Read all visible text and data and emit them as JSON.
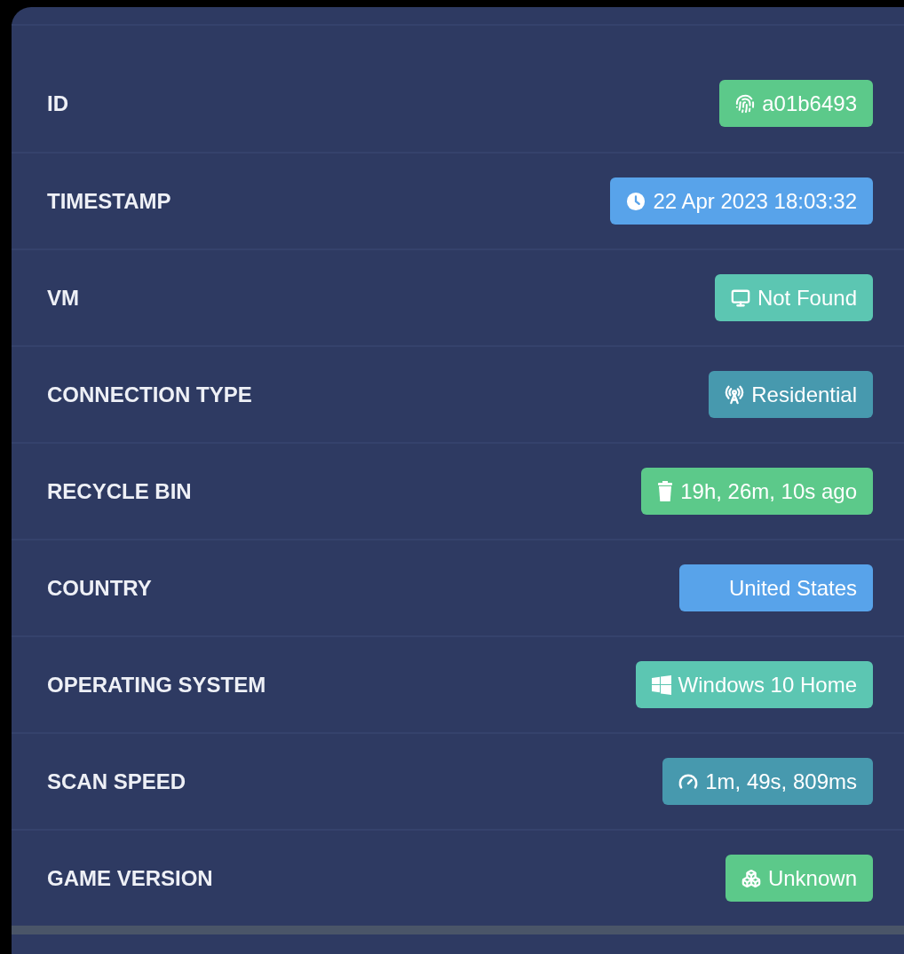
{
  "rows": [
    {
      "label": "ID",
      "value": "a01b6493",
      "color": "#5cc98a"
    },
    {
      "label": "TIMESTAMP",
      "value": "22 Apr 2023 18:03:32",
      "color": "#58a3ea"
    },
    {
      "label": "VM",
      "value": "Not Found",
      "color": "#5cc6b2"
    },
    {
      "label": "CONNECTION TYPE",
      "value": "Residential",
      "color": "#4799ae"
    },
    {
      "label": "RECYCLE BIN",
      "value": "19h, 26m, 10s ago",
      "color": "#5cc98a"
    },
    {
      "label": "COUNTRY",
      "value": "United States",
      "color": "#58a3ea"
    },
    {
      "label": "OPERATING SYSTEM",
      "value": "Windows 10 Home",
      "color": "#5cc6b2"
    },
    {
      "label": "SCAN SPEED",
      "value": "1m, 49s, 809ms",
      "color": "#4799ae"
    },
    {
      "label": "GAME VERSION",
      "value": "Unknown",
      "color": "#5cc98a"
    }
  ]
}
